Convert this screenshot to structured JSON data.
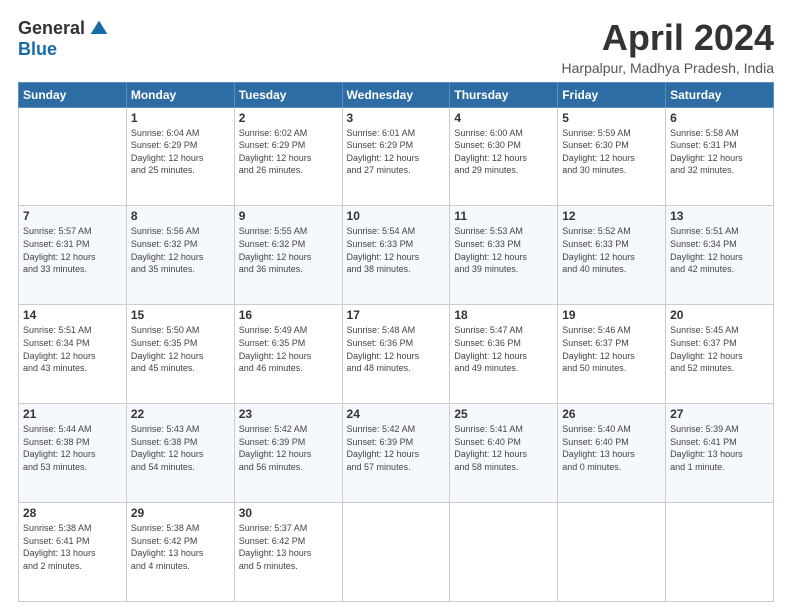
{
  "logo": {
    "general": "General",
    "blue": "Blue"
  },
  "title": "April 2024",
  "location": "Harpalpur, Madhya Pradesh, India",
  "weekdays": [
    "Sunday",
    "Monday",
    "Tuesday",
    "Wednesday",
    "Thursday",
    "Friday",
    "Saturday"
  ],
  "weeks": [
    [
      {
        "day": "",
        "info": ""
      },
      {
        "day": "1",
        "info": "Sunrise: 6:04 AM\nSunset: 6:29 PM\nDaylight: 12 hours\nand 25 minutes."
      },
      {
        "day": "2",
        "info": "Sunrise: 6:02 AM\nSunset: 6:29 PM\nDaylight: 12 hours\nand 26 minutes."
      },
      {
        "day": "3",
        "info": "Sunrise: 6:01 AM\nSunset: 6:29 PM\nDaylight: 12 hours\nand 27 minutes."
      },
      {
        "day": "4",
        "info": "Sunrise: 6:00 AM\nSunset: 6:30 PM\nDaylight: 12 hours\nand 29 minutes."
      },
      {
        "day": "5",
        "info": "Sunrise: 5:59 AM\nSunset: 6:30 PM\nDaylight: 12 hours\nand 30 minutes."
      },
      {
        "day": "6",
        "info": "Sunrise: 5:58 AM\nSunset: 6:31 PM\nDaylight: 12 hours\nand 32 minutes."
      }
    ],
    [
      {
        "day": "7",
        "info": "Sunrise: 5:57 AM\nSunset: 6:31 PM\nDaylight: 12 hours\nand 33 minutes."
      },
      {
        "day": "8",
        "info": "Sunrise: 5:56 AM\nSunset: 6:32 PM\nDaylight: 12 hours\nand 35 minutes."
      },
      {
        "day": "9",
        "info": "Sunrise: 5:55 AM\nSunset: 6:32 PM\nDaylight: 12 hours\nand 36 minutes."
      },
      {
        "day": "10",
        "info": "Sunrise: 5:54 AM\nSunset: 6:33 PM\nDaylight: 12 hours\nand 38 minutes."
      },
      {
        "day": "11",
        "info": "Sunrise: 5:53 AM\nSunset: 6:33 PM\nDaylight: 12 hours\nand 39 minutes."
      },
      {
        "day": "12",
        "info": "Sunrise: 5:52 AM\nSunset: 6:33 PM\nDaylight: 12 hours\nand 40 minutes."
      },
      {
        "day": "13",
        "info": "Sunrise: 5:51 AM\nSunset: 6:34 PM\nDaylight: 12 hours\nand 42 minutes."
      }
    ],
    [
      {
        "day": "14",
        "info": "Sunrise: 5:51 AM\nSunset: 6:34 PM\nDaylight: 12 hours\nand 43 minutes."
      },
      {
        "day": "15",
        "info": "Sunrise: 5:50 AM\nSunset: 6:35 PM\nDaylight: 12 hours\nand 45 minutes."
      },
      {
        "day": "16",
        "info": "Sunrise: 5:49 AM\nSunset: 6:35 PM\nDaylight: 12 hours\nand 46 minutes."
      },
      {
        "day": "17",
        "info": "Sunrise: 5:48 AM\nSunset: 6:36 PM\nDaylight: 12 hours\nand 48 minutes."
      },
      {
        "day": "18",
        "info": "Sunrise: 5:47 AM\nSunset: 6:36 PM\nDaylight: 12 hours\nand 49 minutes."
      },
      {
        "day": "19",
        "info": "Sunrise: 5:46 AM\nSunset: 6:37 PM\nDaylight: 12 hours\nand 50 minutes."
      },
      {
        "day": "20",
        "info": "Sunrise: 5:45 AM\nSunset: 6:37 PM\nDaylight: 12 hours\nand 52 minutes."
      }
    ],
    [
      {
        "day": "21",
        "info": "Sunrise: 5:44 AM\nSunset: 6:38 PM\nDaylight: 12 hours\nand 53 minutes."
      },
      {
        "day": "22",
        "info": "Sunrise: 5:43 AM\nSunset: 6:38 PM\nDaylight: 12 hours\nand 54 minutes."
      },
      {
        "day": "23",
        "info": "Sunrise: 5:42 AM\nSunset: 6:39 PM\nDaylight: 12 hours\nand 56 minutes."
      },
      {
        "day": "24",
        "info": "Sunrise: 5:42 AM\nSunset: 6:39 PM\nDaylight: 12 hours\nand 57 minutes."
      },
      {
        "day": "25",
        "info": "Sunrise: 5:41 AM\nSunset: 6:40 PM\nDaylight: 12 hours\nand 58 minutes."
      },
      {
        "day": "26",
        "info": "Sunrise: 5:40 AM\nSunset: 6:40 PM\nDaylight: 13 hours\nand 0 minutes."
      },
      {
        "day": "27",
        "info": "Sunrise: 5:39 AM\nSunset: 6:41 PM\nDaylight: 13 hours\nand 1 minute."
      }
    ],
    [
      {
        "day": "28",
        "info": "Sunrise: 5:38 AM\nSunset: 6:41 PM\nDaylight: 13 hours\nand 2 minutes."
      },
      {
        "day": "29",
        "info": "Sunrise: 5:38 AM\nSunset: 6:42 PM\nDaylight: 13 hours\nand 4 minutes."
      },
      {
        "day": "30",
        "info": "Sunrise: 5:37 AM\nSunset: 6:42 PM\nDaylight: 13 hours\nand 5 minutes."
      },
      {
        "day": "",
        "info": ""
      },
      {
        "day": "",
        "info": ""
      },
      {
        "day": "",
        "info": ""
      },
      {
        "day": "",
        "info": ""
      }
    ]
  ]
}
